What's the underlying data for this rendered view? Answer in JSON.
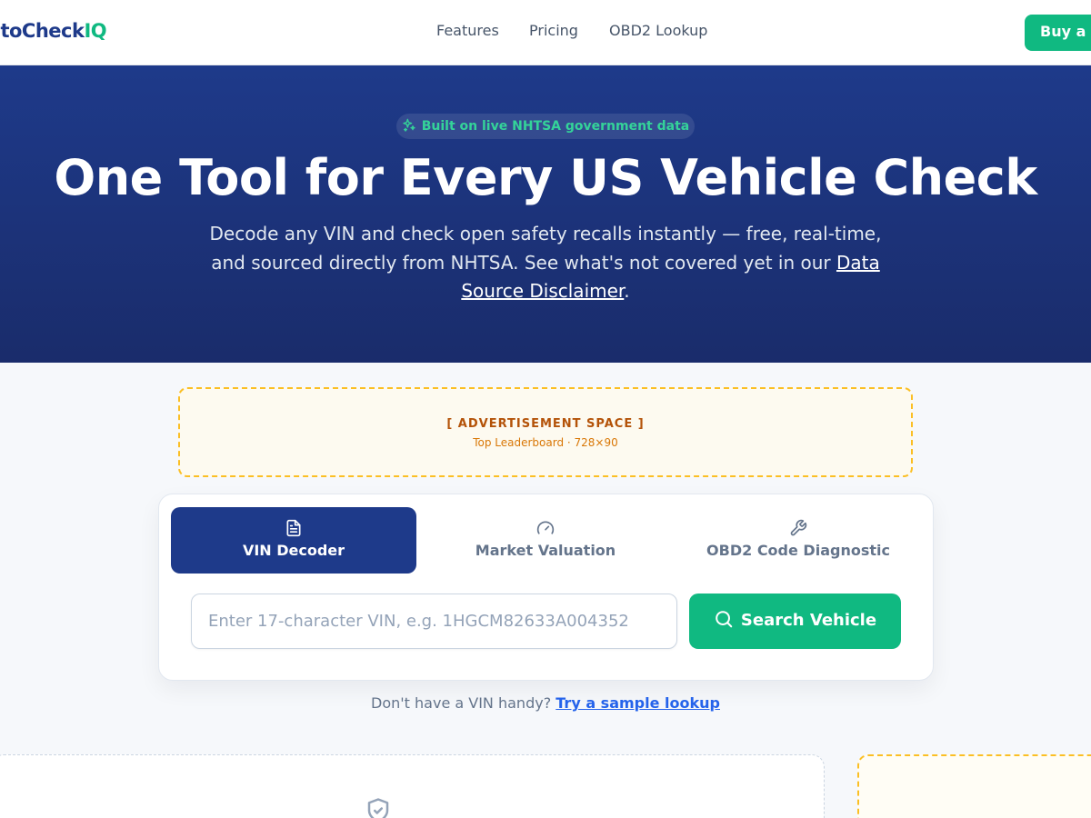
{
  "header": {
    "logo_main": "utoCheck",
    "logo_accent": "IQ",
    "nav": [
      {
        "label": "Features"
      },
      {
        "label": "Pricing"
      },
      {
        "label": "OBD2 Lookup"
      }
    ],
    "cta_label": "Buy a"
  },
  "hero": {
    "badge": "Built on live NHTSA government data",
    "title": "One Tool for Every US Vehicle Check",
    "subtitle_pre": "Decode any VIN and check open safety recalls instantly — free, real-time, and sourced directly from NHTSA. See what's not covered yet in our ",
    "subtitle_link": "Data Source Disclaimer",
    "subtitle_post": "."
  },
  "ad_top": {
    "title": "[ ADVERTISEMENT SPACE ]",
    "subtitle": "Top Leaderboard · 728×90"
  },
  "tool": {
    "tabs": [
      {
        "label": "VIN Decoder",
        "icon": "document-icon",
        "active": true
      },
      {
        "label": "Market Valuation",
        "icon": "gauge-icon",
        "active": false
      },
      {
        "label": "OBD2 Code Diagnostic",
        "icon": "wrench-icon",
        "active": false
      }
    ],
    "input": {
      "value": "",
      "placeholder": "Enter 17-character VIN, e.g. 1HGCM82633A004352"
    },
    "search_label": "Search Vehicle"
  },
  "sample": {
    "prefix": "Don't have a VIN handy? ",
    "link": "Try a sample lookup"
  },
  "colors": {
    "brand_navy": "#1e3a8a",
    "accent_green": "#10b981",
    "ad_border": "#fbbf24",
    "link_blue": "#2563eb"
  }
}
